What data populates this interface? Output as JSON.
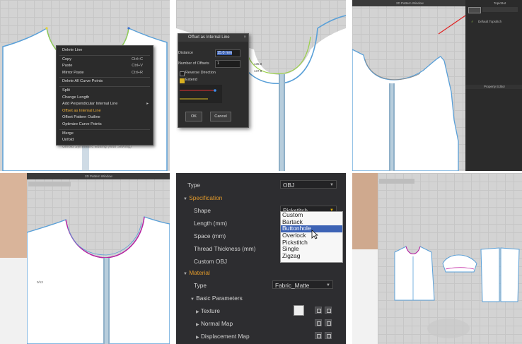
{
  "panel1": {
    "menu_items": [
      {
        "label": "Delete Line",
        "shortcut": ""
      },
      {
        "label": "Copy",
        "shortcut": "Ctrl+C"
      },
      {
        "label": "Paste",
        "shortcut": "Ctrl+V"
      },
      {
        "label": "Mirror Paste",
        "shortcut": "Ctrl+R"
      },
      {
        "label": "Delete All Curve Points",
        "shortcut": ""
      },
      {
        "label": "Split",
        "shortcut": ""
      },
      {
        "label": "Change Length",
        "shortcut": ""
      },
      {
        "label": "Add Perpendicular Internal Line",
        "shortcut": ""
      },
      {
        "label": "Offset as Internal Line",
        "shortcut": ""
      },
      {
        "label": "Offset Pattern Outline",
        "shortcut": ""
      },
      {
        "label": "Optimize Curve Points",
        "shortcut": ""
      },
      {
        "label": "Merge",
        "shortcut": ""
      },
      {
        "label": "Unfold",
        "shortcut": ""
      },
      {
        "label": "Unfold Symmetric Editing (with Sewing)",
        "shortcut": ""
      }
    ],
    "highlighted_index": 8,
    "disabled_index": 13
  },
  "panel2": {
    "dialog_title": "Offset as Internal Line",
    "close_glyph": "×",
    "distance_label": "Distance",
    "distance_value": "15.0 mm",
    "offsets_label": "Number of Offsets",
    "offsets_value": "1",
    "reverse_label": "Reverse Direction",
    "extend_label": "Extend",
    "ok_label": "OK",
    "cancel_label": "Cancel",
    "measure_1": "135.8",
    "measure_2": "137.8"
  },
  "panel3": {
    "window_title": "2D Pattern Window",
    "side_title": "TopicBot",
    "list_item": "Default Topstitch",
    "property_header": "Property Editor"
  },
  "panel4": {
    "window_title": "2D Pattern Window",
    "side_label": "0/13"
  },
  "panel5": {
    "type_label": "Type",
    "type_value": "OBJ",
    "specification_label": "Specification",
    "shape_label": "Shape",
    "shape_value": "Pickstitch",
    "length_label": "Length (mm)",
    "space_label": "Space (mm)",
    "thread_label": "Thread Thickness (mm)",
    "custom_obj_label": "Custom OBJ",
    "shape_options": [
      "Custom",
      "Bartack",
      "Buttonhole",
      "Overlock",
      "Pickstitch",
      "Single",
      "Zigzag"
    ],
    "selected_option_index": 2,
    "material_label": "Material",
    "material_type_label": "Type",
    "material_type_value": "Fabric_Matte",
    "basic_params_label": "Basic Parameters",
    "texture_label": "Texture",
    "normal_map_label": "Normal Map",
    "displacement_label": "Displacement Map"
  },
  "colors": {
    "grid_bg": "#d3d3d3",
    "pattern_fill": "#ffffff",
    "outline_blue": "#5aa0d8",
    "seam_magenta": "#c020a0",
    "menu_highlight": "#f2b035",
    "section_orange": "#e29a2b",
    "select_blue": "#3d63b5"
  }
}
